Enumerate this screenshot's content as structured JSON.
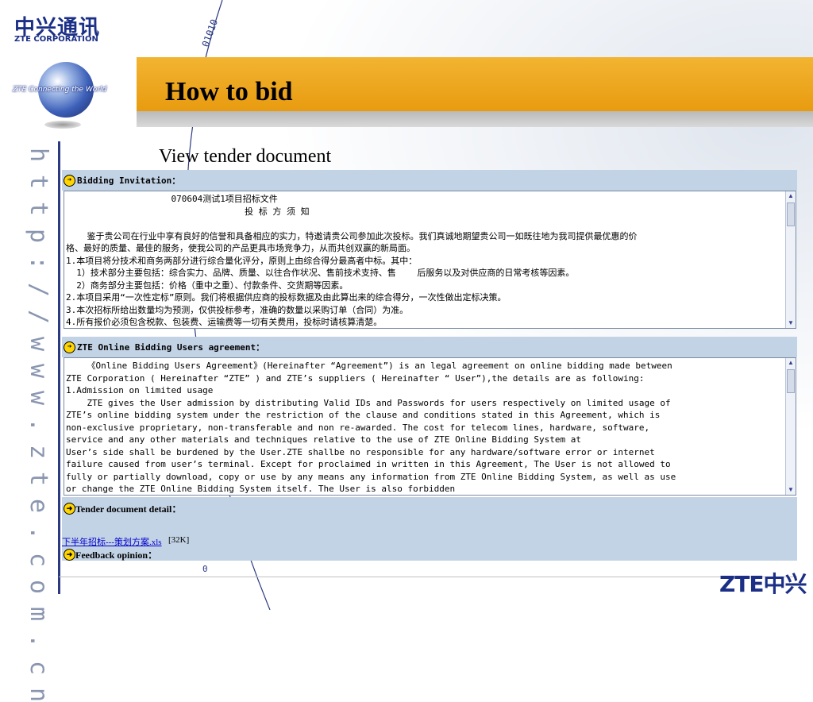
{
  "logo": {
    "cn": "中兴通讯",
    "en": "ZTE CORPORATION",
    "globe_caption": "ZTE Connecting the World",
    "bottom_right": "ZTE中兴"
  },
  "slide": {
    "title": "How to bid",
    "subtitle": "View tender document",
    "vertical_url": "http://www.zte.com.cn"
  },
  "panels": {
    "bidding_invitation": {
      "label": "Bidding Invitation：",
      "lines": [
        "                    070604测试1项目招标文件",
        "                                  投 标 方 须 知",
        "",
        "    鉴于贵公司在行业中享有良好的信誉和具备相应的实力，特邀请贵公司参加此次投标。我们真诚地期望贵公司一如既往地为我司提供最优惠的价",
        "格、最好的质量、最佳的服务，使我公司的产品更具市场竞争力，从而共创双赢的新局面。",
        "1.本项目将分技术和商务两部分进行综合量化评分，原则上由综合得分最高者中标。其中：",
        "  1）技术部分主要包括：综合实力、品牌、质量、以往合作状况、售前技术支持、售    后服务以及对供应商的日常考核等因素。",
        "  2）商务部分主要包括：价格（重中之重）、付款条件、交货期等因素。",
        "2.本项目采用“一次性定标”原则。我们将根据供应商的投标数据及由此算出来的综合得分，一次性做出定标决策。",
        "3.本次招标所给出数量均为预测，仅供投标参考，准确的数量以采购订单（合同）为准。",
        "4.所有报价必须包含税款、包装费、运输费等一切有关费用，投标时请核算清楚。"
      ]
    },
    "agreement": {
      "label": "ZTE Online Bidding Users agreement：",
      "lines": [
        "    《Online Bidding Users Agreement》(Hereinafter “Agreement”) is an legal agreement on online bidding made between",
        "ZTE Corporation ( Hereinafter “ZTE” ) and ZTE’s suppliers ( Hereinafter “ User”),the details are as following:",
        "1.Admission on limited usage",
        "    ZTE gives the User admission by distributing Valid IDs and Passwords for users respectively on limited usage of",
        "ZTE’s online bidding system under the restriction of the clause and conditions stated in this Agreement, which is",
        "non-exclusive proprietary, non-transferable and non re-awarded. The cost for telecom lines, hardware, software,",
        "service and any other materials and techniques relative to the use of ZTE Online Bidding System at",
        "User’s side shall be burdened by the User.ZTE shallbe no responsible for any hardware/software error or internet",
        "failure caused from user’s terminal. Except for proclaimed in written in this Agreement, The User is not allowed to",
        "fully or partially download, copy or use by any means any information from ZTE Online Bidding System, as well as use",
        "or change the ZTE Online Bidding System itself. The User is also forbidden"
      ]
    },
    "tender_detail": {
      "label": "Tender document detail：",
      "file_name": "下半年招标---策划方案.xls",
      "file_size": "[32K]"
    },
    "feedback": {
      "label": "Feedback opinion："
    }
  },
  "colors": {
    "title_bar": "#f2b431",
    "panel_bg": "#c3d3e6",
    "brand_blue": "#1b2f86"
  }
}
